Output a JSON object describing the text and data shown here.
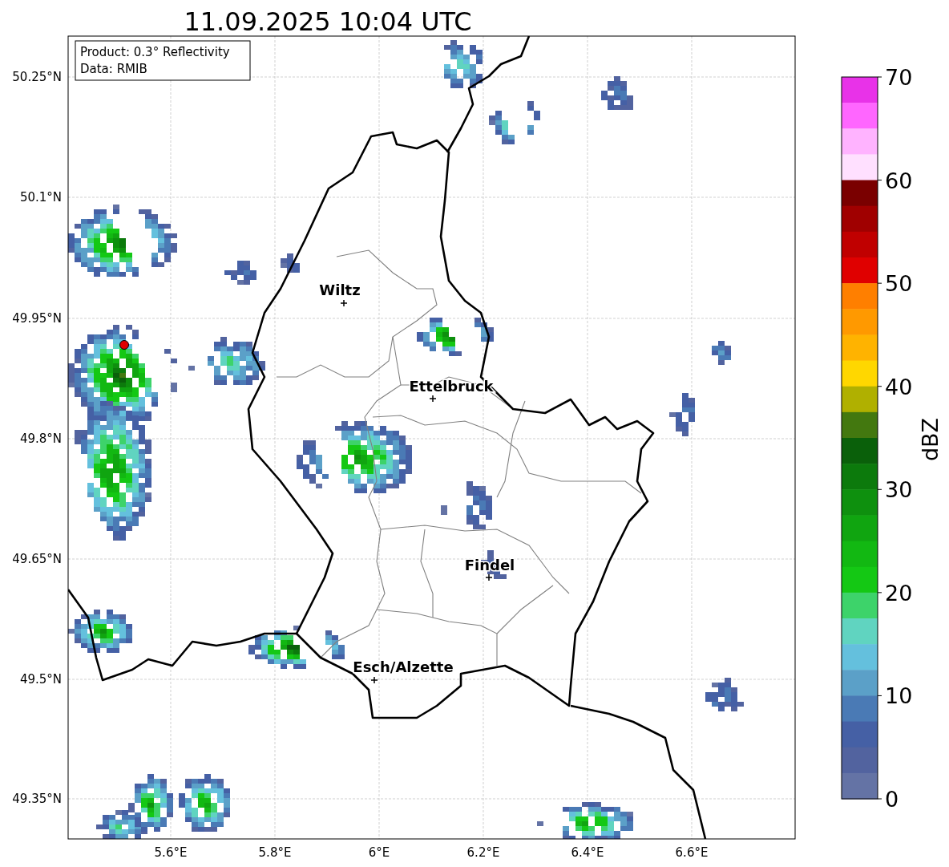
{
  "title": "11.09.2025 10:04 UTC",
  "info_box": [
    "Product: 0.3° Reflectivity",
    "Data: RMIB"
  ],
  "lat_ticks": [
    "50.25°N",
    "50.1°N",
    "49.95°N",
    "49.8°N",
    "49.65°N",
    "49.5°N",
    "49.35°N"
  ],
  "lon_ticks": [
    "5.6°E",
    "5.8°E",
    "6°E",
    "6.2°E",
    "6.4°E",
    "6.6°E"
  ],
  "cities": [
    {
      "name": "Wiltz"
    },
    {
      "name": "Ettelbruck"
    },
    {
      "name": "Findel"
    },
    {
      "name": "Esch/Alzette"
    }
  ],
  "colorbar": {
    "label": "dBZ",
    "ticks": [
      "70",
      "60",
      "50",
      "40",
      "30",
      "20",
      "10",
      "0"
    ],
    "segments": [
      {
        "color": "#e832e8"
      },
      {
        "color": "#ff66ff"
      },
      {
        "color": "#ffb3ff"
      },
      {
        "color": "#ffe0ff"
      },
      {
        "color": "#7a0000"
      },
      {
        "color": "#a00000"
      },
      {
        "color": "#c00000"
      },
      {
        "color": "#e00000"
      },
      {
        "color": "#ff7f00"
      },
      {
        "color": "#ff9900"
      },
      {
        "color": "#ffb300"
      },
      {
        "color": "#ffd700"
      },
      {
        "color": "#b0b000"
      },
      {
        "color": "#43780f"
      },
      {
        "color": "#0a600a"
      },
      {
        "color": "#0c7a0c"
      },
      {
        "color": "#0e900e"
      },
      {
        "color": "#10a510"
      },
      {
        "color": "#12b812"
      },
      {
        "color": "#14c814"
      },
      {
        "color": "#3dd36a"
      },
      {
        "color": "#60d4c0"
      },
      {
        "color": "#64c0dd"
      },
      {
        "color": "#5ba0c8"
      },
      {
        "color": "#4a7ab5"
      },
      {
        "color": "#4560a5"
      },
      {
        "color": "#52639f"
      },
      {
        "color": "#6473a5"
      }
    ]
  }
}
